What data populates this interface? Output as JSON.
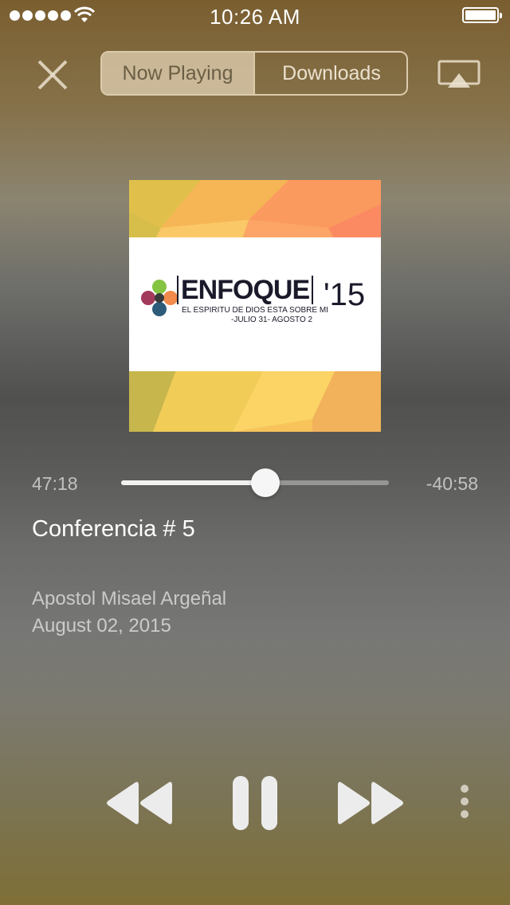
{
  "status_bar": {
    "time": "10:26 AM",
    "signal_bars": 5
  },
  "nav": {
    "tabs": [
      {
        "label": "Now Playing",
        "active": true
      },
      {
        "label": "Downloads",
        "active": false
      }
    ]
  },
  "artwork": {
    "title": "ENFOQUE",
    "year": "'15",
    "subtitle": "EL ESPIRITU DE DIOS ESTA SOBRE MI",
    "dates": "-JULIO 31- AGOSTO 2"
  },
  "player": {
    "elapsed": "47:18",
    "remaining": "-40:58",
    "progress": 0.54,
    "track_title": "Conferencia # 5",
    "artist": "Apostol Misael Argeñal",
    "date": "August 02, 2015"
  },
  "colors": {
    "accent": "#ffffff",
    "segment_active": "#e1d2b4"
  }
}
